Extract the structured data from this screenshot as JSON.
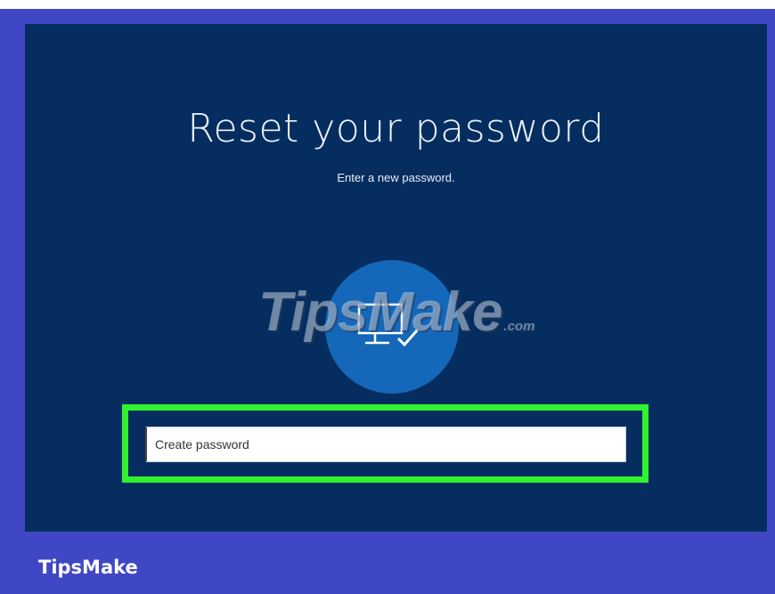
{
  "screen": {
    "title": "Reset your password",
    "subtitle": "Enter a new password."
  },
  "avatar": {
    "icon": "monitor-check-icon",
    "color": "#1467b9"
  },
  "password_field": {
    "placeholder": "Create password",
    "value": ""
  },
  "highlight": {
    "color": "#2ff32f"
  },
  "watermark": {
    "text": "TipsMake",
    "suffix": ".com"
  },
  "footer": {
    "brand": "TipsMake"
  },
  "colors": {
    "frame": "#4047c4",
    "screen_bg": "#062d5f"
  }
}
